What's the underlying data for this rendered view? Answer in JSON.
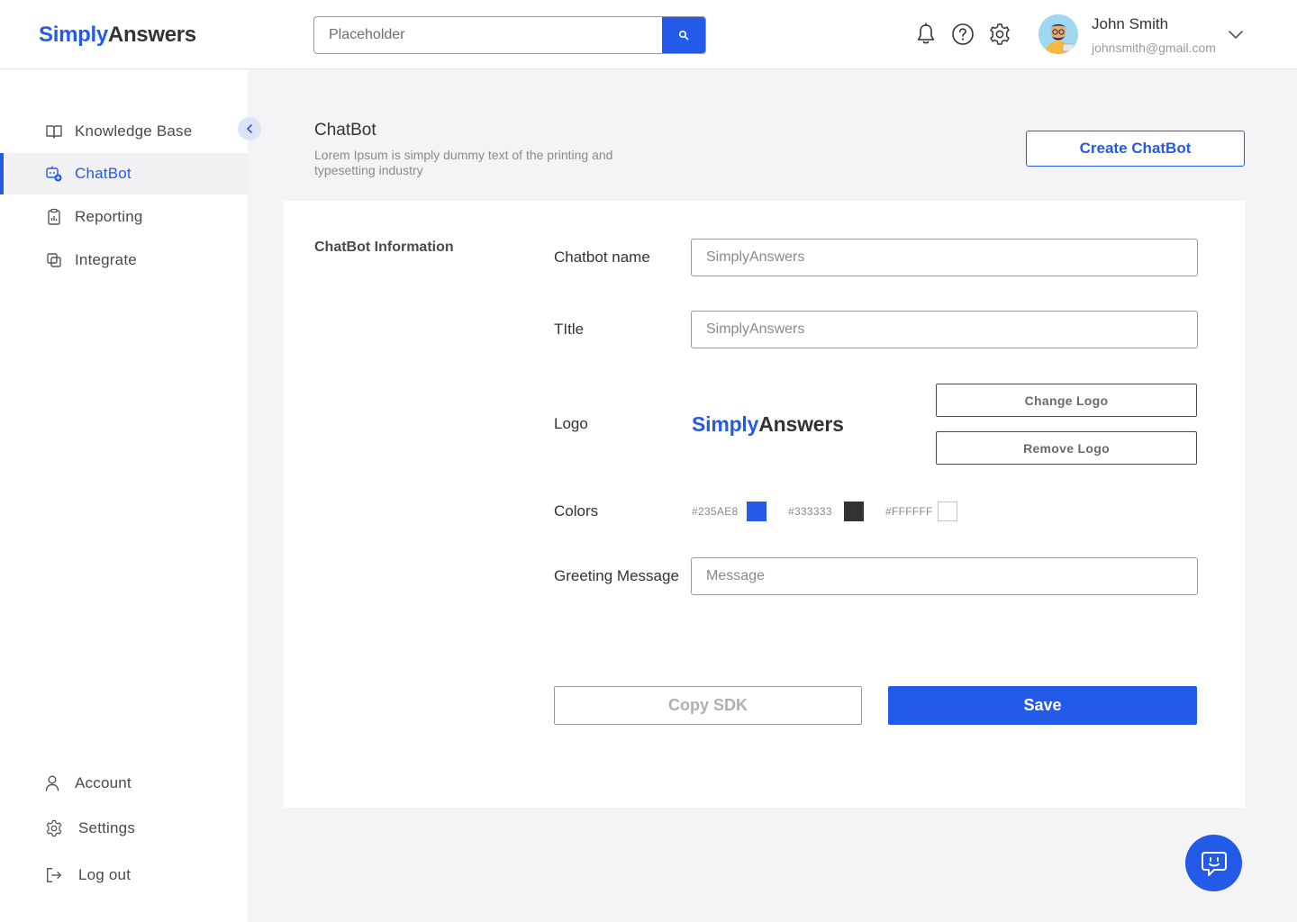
{
  "header": {
    "logo_part1": "Simply",
    "logo_part2": "Answers",
    "search_placeholder": "Placeholder",
    "icons": [
      "bell-icon",
      "help-icon",
      "gear-icon"
    ],
    "user": {
      "name": "John Smith",
      "email": "johnsmith@gmail.com"
    }
  },
  "sidebar": {
    "items": [
      {
        "label": "Knowledge Base",
        "icon": "book-icon"
      },
      {
        "label": "ChatBot",
        "icon": "chatbot-icon",
        "active": true
      },
      {
        "label": "Reporting",
        "icon": "clipboard-icon"
      },
      {
        "label": "Integrate",
        "icon": "integrate-icon"
      }
    ],
    "bottom_items": [
      {
        "label": "Account",
        "icon": "user-icon"
      },
      {
        "label": "Settings",
        "icon": "gear-icon"
      },
      {
        "label": "Log out",
        "icon": "logout-icon"
      }
    ]
  },
  "page": {
    "title": "ChatBot",
    "description": "Lorem Ipsum is simply dummy text of the printing and typesetting industry",
    "create_button": "Create ChatBot"
  },
  "form": {
    "section_title": "ChatBot Information",
    "chatbot_name_label": "Chatbot name",
    "chatbot_name_value": "SimplyAnswers",
    "title_label": "TItle",
    "title_value": "SimplyAnswers",
    "logo_label": "Logo",
    "logo_preview_part1": "Simply",
    "logo_preview_part2": "Answers",
    "change_logo": "Change  Logo",
    "remove_logo": "Remove  Logo",
    "colors_label": "Colors",
    "colors": [
      {
        "hex_label": "#235AE8",
        "color": "#235AE8"
      },
      {
        "hex_label": "#333333",
        "color": "#333333"
      },
      {
        "hex_label": "#FFFFFF",
        "color": "#FFFFFF"
      }
    ],
    "greeting_label": "Greeting Message",
    "greeting_placeholder": "Message",
    "copy_sdk": "Copy SDK",
    "save": "Save"
  },
  "theme": {
    "accent": "#235AE8",
    "text": "#333333",
    "background": "#F4F4F6"
  }
}
